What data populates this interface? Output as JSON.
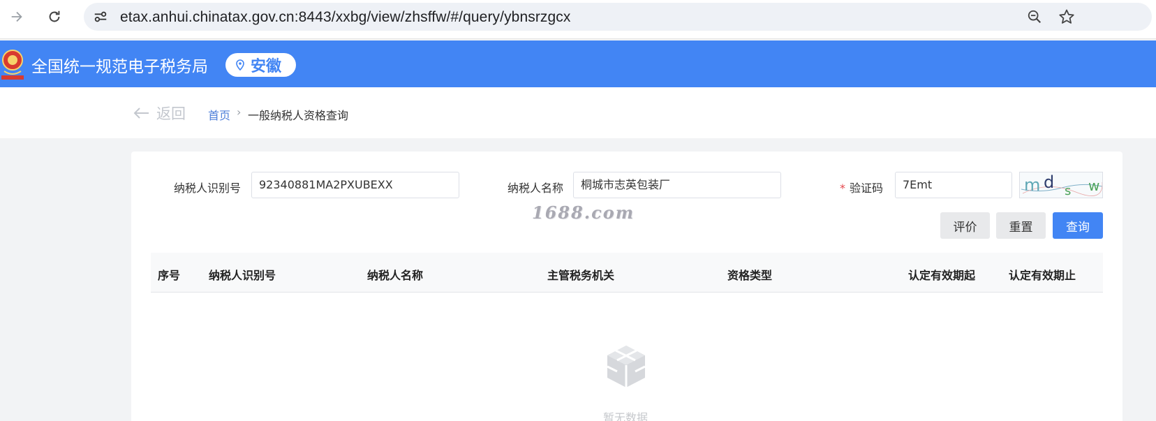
{
  "browser": {
    "url": "etax.anhui.chinatax.gov.cn:8443/xxbg/view/zhsffw/#/query/ybnsrzgcx",
    "icons": [
      "forward-arrow-icon",
      "reload-icon",
      "site-info-icon",
      "zoom-icon",
      "bookmark-star-icon"
    ]
  },
  "header": {
    "title": "全国统一规范电子税务局",
    "region": "安徽",
    "brand_color": "#4285f4"
  },
  "breadcrumb": {
    "back_label": "返回",
    "home": "首页",
    "separator": "›",
    "current": "一般纳税人资格查询"
  },
  "form": {
    "taxpayer_id_label": "纳税人识别号",
    "taxpayer_id_value": "92340881MA2PXUBEXX",
    "taxpayer_name_label": "纳税人名称",
    "taxpayer_name_value": "桐城市志英包装厂",
    "captcha_required_mark": "*",
    "captcha_label": "验证码",
    "captcha_value": "7Emt",
    "captcha_image_text": "mdsw"
  },
  "watermark": "1688.com",
  "buttons": {
    "evaluate": "评价",
    "reset": "重置",
    "query": "查询"
  },
  "table": {
    "columns": [
      "序号",
      "纳税人识别号",
      "纳税人名称",
      "主管税务机关",
      "资格类型",
      "认定有效期起",
      "认定有效期止"
    ],
    "rows": [],
    "empty_text": "暂无数据"
  }
}
